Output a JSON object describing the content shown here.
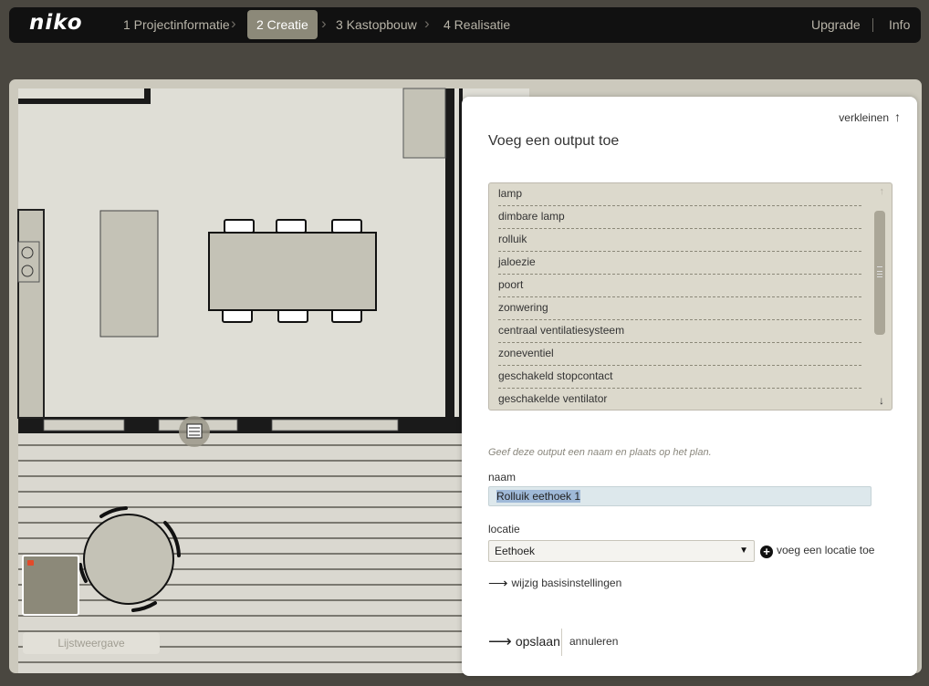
{
  "header": {
    "logo": "niko",
    "steps": [
      {
        "label": "1 Projectinformatie",
        "active": false
      },
      {
        "label": "2 Creatie",
        "active": true
      },
      {
        "label": "3 Kastopbouw",
        "active": false
      },
      {
        "label": "4 Realisatie",
        "active": false
      }
    ],
    "upgrade": "Upgrade",
    "info": "Info"
  },
  "canvas": {
    "list_view": "Lijstweergave"
  },
  "panel": {
    "collapse": "verkleinen",
    "title": "Voeg een output toe",
    "outputs": [
      "lamp",
      "dimbare lamp",
      "rolluik",
      "jaloezie",
      "poort",
      "zonwering",
      "centraal ventilatiesysteem",
      "zoneventiel",
      "geschakeld stopcontact",
      "geschakelde ventilator"
    ],
    "hint": "Geef deze output een naam en plaats op het plan.",
    "name_label": "naam",
    "name_value": "Rolluik eethoek 1",
    "location_label": "locatie",
    "location_value": "Eethoek",
    "add_location": "voeg een locatie toe",
    "basic_settings": "wijzig basisinstellingen",
    "save": "opslaan",
    "cancel": "annuleren"
  },
  "colors": {
    "nav_bg": "#111111",
    "nav_active": "#8c8979",
    "list_bg": "#dcd9cc",
    "floor": "#dfded6",
    "furniture": "#c4c2b6"
  }
}
